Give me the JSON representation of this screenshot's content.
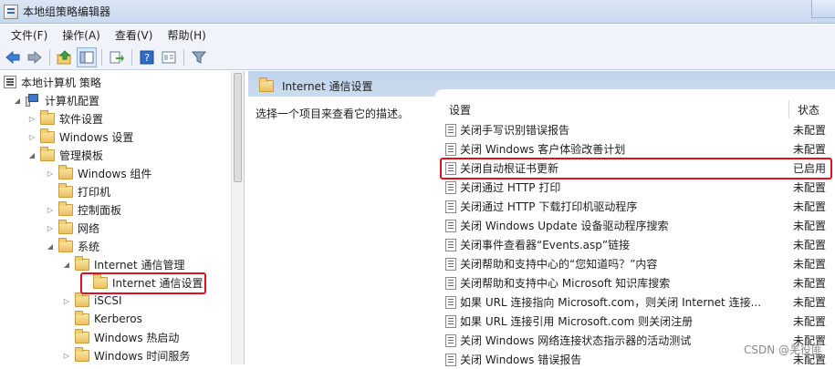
{
  "window": {
    "title": "本地组策略编辑器"
  },
  "menu": {
    "items": [
      "文件(F)",
      "操作(A)",
      "查看(V)",
      "帮助(H)"
    ]
  },
  "toolbar": {
    "icons": [
      "back-arrow-icon",
      "forward-arrow-icon",
      "up-folder-icon",
      "show-hide-tree-icon",
      "export-list-icon",
      "help-icon",
      "properties-icon",
      "filter-icon"
    ]
  },
  "tree": {
    "items": [
      {
        "label": "本地计算机 策略",
        "level": 0,
        "arrow": "",
        "icon": "policy"
      },
      {
        "label": "计算机配置",
        "level": 1,
        "arrow": "◢",
        "icon": "computer"
      },
      {
        "label": "软件设置",
        "level": 2,
        "arrow": "▷",
        "icon": "folder"
      },
      {
        "label": "Windows 设置",
        "level": 2,
        "arrow": "▷",
        "icon": "folder"
      },
      {
        "label": "管理模板",
        "level": 2,
        "arrow": "◢",
        "icon": "folder"
      },
      {
        "label": "Windows 组件",
        "level": 3,
        "arrow": "▷",
        "icon": "folder"
      },
      {
        "label": "打印机",
        "level": 3,
        "arrow": "",
        "icon": "folder"
      },
      {
        "label": "控制面板",
        "level": 3,
        "arrow": "▷",
        "icon": "folder"
      },
      {
        "label": "网络",
        "level": 3,
        "arrow": "▷",
        "icon": "folder"
      },
      {
        "label": "系统",
        "level": 3,
        "arrow": "◢",
        "icon": "folder"
      },
      {
        "label": "Internet 通信管理",
        "level": 4,
        "arrow": "◢",
        "icon": "folder"
      },
      {
        "label": "Internet 通信设置",
        "level": 5,
        "arrow": "",
        "icon": "folder",
        "selected": true
      },
      {
        "label": "iSCSI",
        "level": 4,
        "arrow": "▷",
        "icon": "folder"
      },
      {
        "label": "Kerberos",
        "level": 4,
        "arrow": "",
        "icon": "folder"
      },
      {
        "label": "Windows 热启动",
        "level": 4,
        "arrow": "",
        "icon": "folder"
      },
      {
        "label": "Windows 时间服务",
        "level": 4,
        "arrow": "▷",
        "icon": "folder"
      }
    ]
  },
  "details": {
    "header_title": "Internet 通信设置",
    "description": "选择一个项目来查看它的描述。",
    "columns": {
      "setting": "设置",
      "state": "状态"
    },
    "rows": [
      {
        "name": "关闭手写识别错误报告",
        "state": "未配置"
      },
      {
        "name": "关闭 Windows 客户体验改善计划",
        "state": "未配置"
      },
      {
        "name": "关闭自动根证书更新",
        "state": "已启用",
        "highlighted": true
      },
      {
        "name": "关闭通过 HTTP 打印",
        "state": "未配置"
      },
      {
        "name": "关闭通过 HTTP 下载打印机驱动程序",
        "state": "未配置"
      },
      {
        "name": "关闭 Windows Update 设备驱动程序搜索",
        "state": "未配置"
      },
      {
        "name": "关闭事件查看器“Events.asp”链接",
        "state": "未配置"
      },
      {
        "name": "关闭帮助和支持中心的“您知道吗？”内容",
        "state": "未配置"
      },
      {
        "name": "关闭帮助和支持中心 Microsoft 知识库搜索",
        "state": "未配置"
      },
      {
        "name": "如果 URL 连接指向 Microsoft.com，则关闭 Internet 连接...",
        "state": "未配置"
      },
      {
        "name": "如果 URL 连接引用 Microsoft.com 则关闭注册",
        "state": "未配置"
      },
      {
        "name": "关闭 Windows 网络连接状态指示器的活动测试",
        "state": "未配置"
      },
      {
        "name": "关闭 Windows 错误报告",
        "state": "未配置"
      }
    ]
  },
  "watermark": "CSDN @羌役匪"
}
